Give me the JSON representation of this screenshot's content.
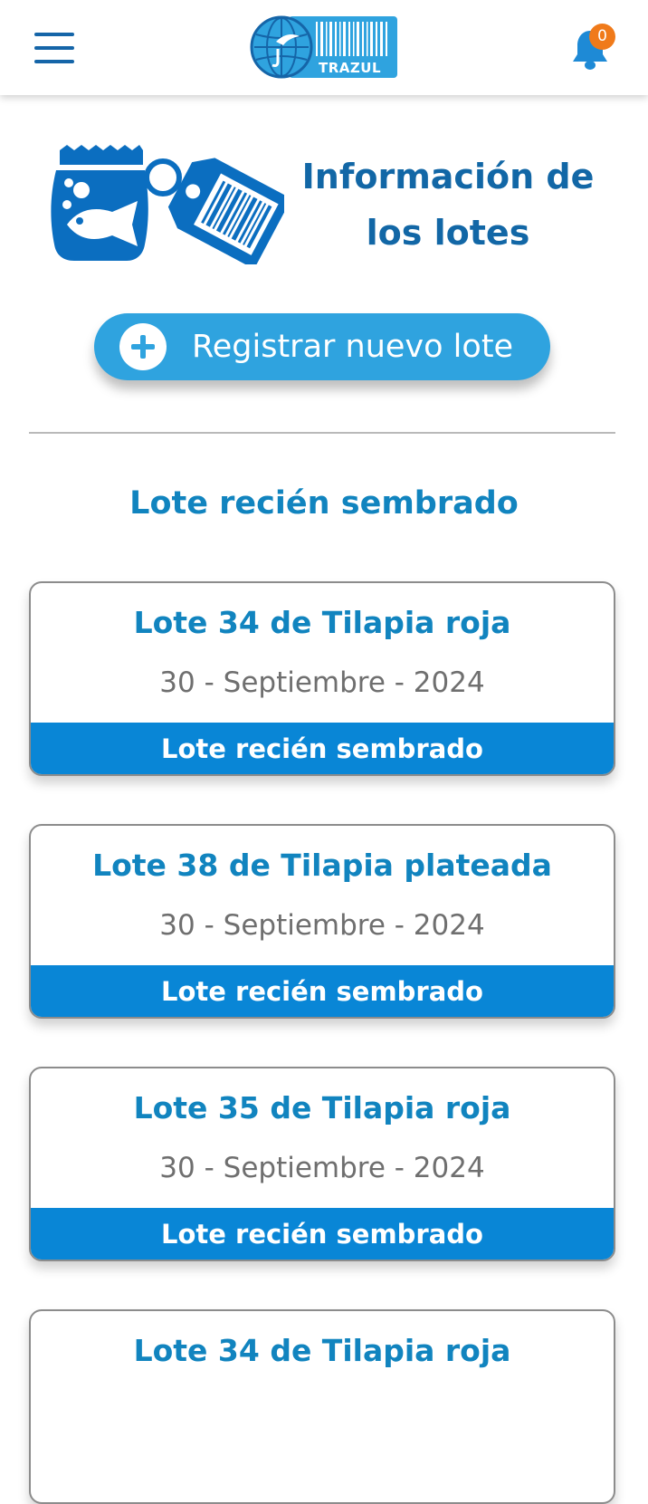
{
  "header": {
    "logo_text": "TRAZUL",
    "notification_count": "0",
    "accent_color": "#1565a8",
    "badge_color": "#f07a1a"
  },
  "hero": {
    "title_line1": "Información de",
    "title_line2": "los lotes"
  },
  "actions": {
    "register_label": "Registrar nuevo lote"
  },
  "section": {
    "title": "Lote recién sembrado"
  },
  "lots": [
    {
      "title": "Lote 34 de Tilapia roja",
      "date": "30 - Septiembre - 2024",
      "status": "Lote recién sembrado"
    },
    {
      "title": "Lote 38 de Tilapia plateada",
      "date": "30 - Septiembre - 2024",
      "status": "Lote recién sembrado"
    },
    {
      "title": "Lote 35 de Tilapia roja",
      "date": "30 - Septiembre - 2024",
      "status": "Lote recién sembrado"
    },
    {
      "title": "Lote 34 de Tilapia roja",
      "date": "",
      "status": ""
    }
  ],
  "colors": {
    "primary_blue": "#0986d6",
    "button_blue": "#2fa3df",
    "title_blue": "#1184bf"
  },
  "icons": {
    "menu": "hamburger-menu-icon",
    "bell": "bell-icon",
    "hero": "fish-bag-tag-icon",
    "add": "plus-circle-icon"
  }
}
